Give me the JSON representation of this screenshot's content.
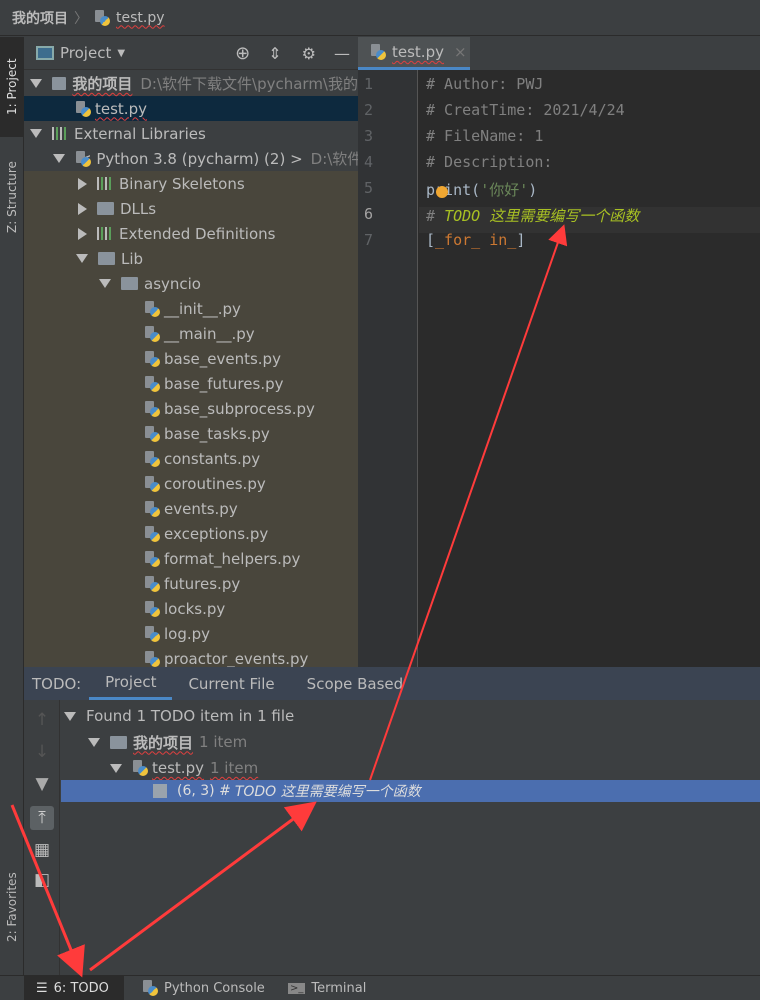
{
  "breadcrumb": {
    "project": "我的项目",
    "separator": "〉",
    "file": "test.py"
  },
  "left_strip": {
    "project_tab": "1: Project",
    "structure_tab": "Z: Structure",
    "favorites_tab": "2: Favorites"
  },
  "project_panel": {
    "title": "Project",
    "tree": [
      {
        "label": "我的项目",
        "detail": "D:\\软件下载文件\\pycharm\\我的",
        "icon": "folder-icon",
        "level": 0,
        "expanded": true,
        "bold": true
      },
      {
        "label": "test.py",
        "icon": "python-file-icon",
        "level": 1,
        "selected": true
      },
      {
        "label": "External Libraries",
        "icon": "library-icon",
        "level": 0,
        "expanded": true
      },
      {
        "label": "< Python 3.8 (pycharm) (2) >",
        "detail": "D:\\软件",
        "icon": "python-icon",
        "level": 1,
        "expanded": true
      },
      {
        "label": "Binary Skeletons",
        "icon": "library-icon",
        "level": 2,
        "collapsed": true
      },
      {
        "label": "DLLs",
        "icon": "folder-icon",
        "level": 2,
        "collapsed": true
      },
      {
        "label": "Extended Definitions",
        "icon": "library-icon",
        "level": 2,
        "collapsed": true
      },
      {
        "label": "Lib",
        "icon": "folder-icon",
        "level": 2,
        "expanded": true
      },
      {
        "label": "asyncio",
        "icon": "folder-icon",
        "level": 3,
        "expanded": true
      },
      {
        "label": "__init__.py",
        "icon": "python-file-icon",
        "level": 4
      },
      {
        "label": "__main__.py",
        "icon": "python-file-icon",
        "level": 4
      },
      {
        "label": "base_events.py",
        "icon": "python-file-icon",
        "level": 4
      },
      {
        "label": "base_futures.py",
        "icon": "python-file-icon",
        "level": 4
      },
      {
        "label": "base_subprocess.py",
        "icon": "python-file-icon",
        "level": 4
      },
      {
        "label": "base_tasks.py",
        "icon": "python-file-icon",
        "level": 4
      },
      {
        "label": "constants.py",
        "icon": "python-file-icon",
        "level": 4
      },
      {
        "label": "coroutines.py",
        "icon": "python-file-icon",
        "level": 4
      },
      {
        "label": "events.py",
        "icon": "python-file-icon",
        "level": 4
      },
      {
        "label": "exceptions.py",
        "icon": "python-file-icon",
        "level": 4
      },
      {
        "label": "format_helpers.py",
        "icon": "python-file-icon",
        "level": 4
      },
      {
        "label": "futures.py",
        "icon": "python-file-icon",
        "level": 4
      },
      {
        "label": "locks.py",
        "icon": "python-file-icon",
        "level": 4
      },
      {
        "label": "log.py",
        "icon": "python-file-icon",
        "level": 4
      },
      {
        "label": "proactor_events.py",
        "icon": "python-file-icon",
        "level": 4
      }
    ]
  },
  "editor": {
    "tab": "test.py",
    "lines": [
      {
        "n": "1",
        "text": "# Author: PWJ"
      },
      {
        "n": "2",
        "text": "# CreatTime: 2021/4/24"
      },
      {
        "n": "3",
        "text": "# FileName: 1"
      },
      {
        "n": "4",
        "text": "# Description:"
      },
      {
        "n": "5",
        "a": "print(",
        "b": "'你好'",
        "c": ")"
      },
      {
        "n": "6",
        "a": "# ",
        "b": "TODO 这里需要编写一个函数"
      },
      {
        "n": "7",
        "a": "[",
        "b": "_for_ in_",
        "c": "]"
      }
    ]
  },
  "todo": {
    "label": "TODO:",
    "tabs": [
      "Project",
      "Current File",
      "Scope Based"
    ],
    "summary": "Found 1 TODO item in 1 file",
    "project": "我的项目",
    "project_count": "1 item",
    "file": "test.py",
    "file_count": "1 item",
    "item_pos": "(6, 3) # ",
    "item_text": "TODO 这里需要编写一个函数"
  },
  "bottom_bar": {
    "todo": "6: TODO",
    "console": "Python Console",
    "terminal": "Terminal"
  },
  "colors": {
    "accent": "#4a88c7",
    "todo": "#a8c023",
    "selection": "#4b6eaf",
    "arrow": "#ff3b3b"
  }
}
